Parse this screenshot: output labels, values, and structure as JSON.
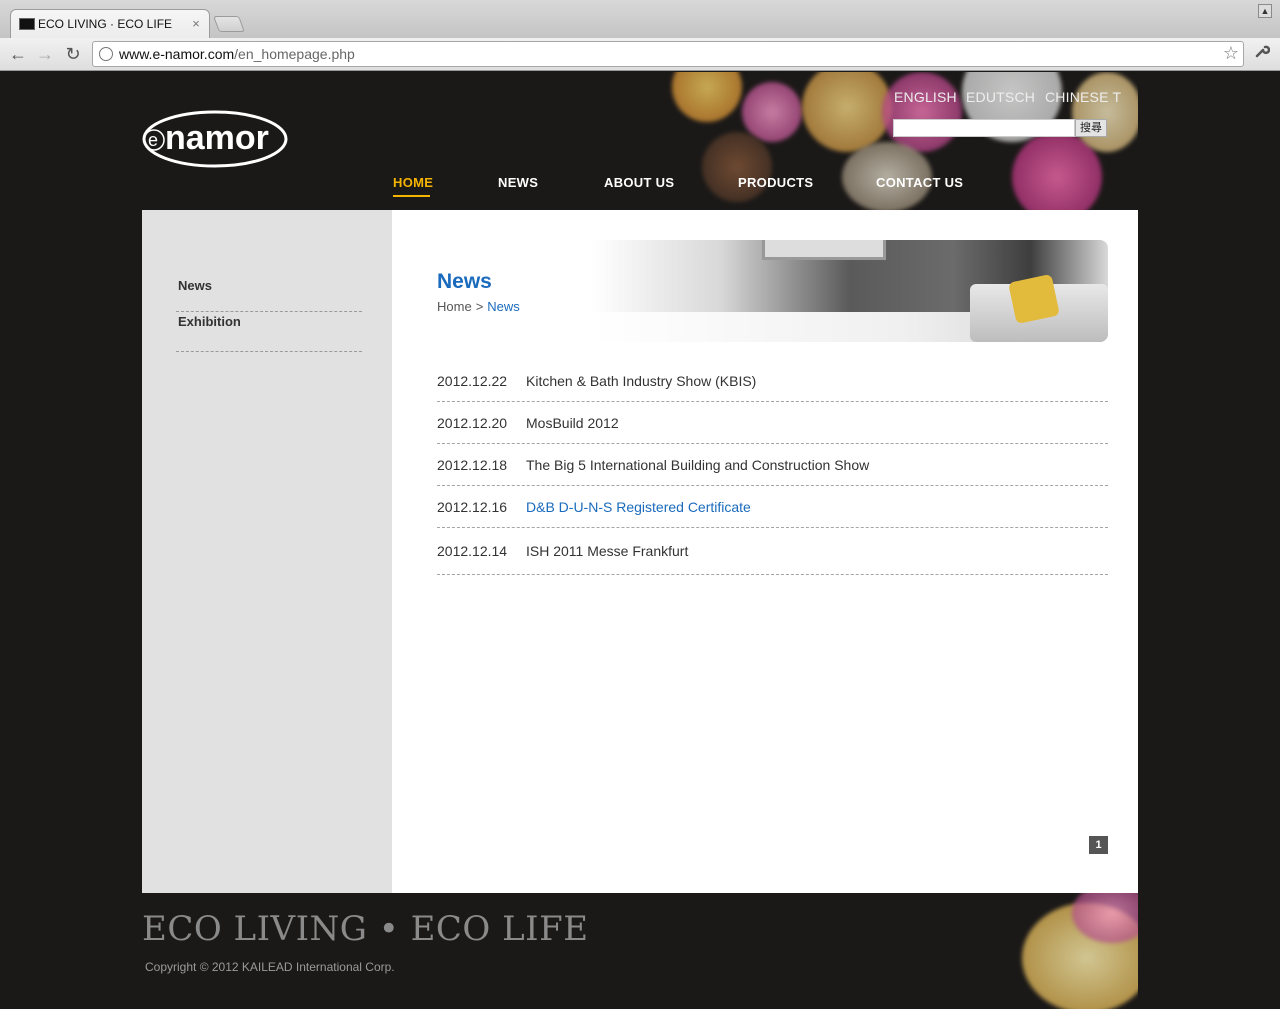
{
  "browser": {
    "tab_title": "ECO LIVING · ECO LIFE",
    "tab_close": "×",
    "url_host": "www.e-namor.com",
    "url_path": "/en_homepage.php",
    "back": "←",
    "forward": "→",
    "reload": "↻",
    "star": "☆",
    "wrench": "🔧"
  },
  "header": {
    "logo_text": "namor",
    "logo_e": "e",
    "languages": [
      "ENGLISH",
      "EDUTSCH",
      "CHINESE T"
    ],
    "search_button": "搜尋",
    "search_placeholder": "",
    "nav": [
      "HOME",
      "NEWS",
      "ABOUT US",
      "PRODUCTS",
      "CONTACT US"
    ],
    "active_nav": "HOME"
  },
  "sidebar": {
    "items": [
      "News",
      "Exhibition"
    ]
  },
  "main": {
    "title": "News",
    "breadcrumb": {
      "home": "Home",
      "sep": ">",
      "current": "News"
    },
    "news": [
      {
        "date": "2012.12.22",
        "title": "Kitchen & Bath Industry Show (KBIS)"
      },
      {
        "date": "2012.12.20",
        "title": "MosBuild 2012"
      },
      {
        "date": "2012.12.18",
        "title": "The Big 5 International Building and Construction Show"
      },
      {
        "date": "2012.12.16",
        "title": "D&B D-U-N-S Registered Certificate"
      },
      {
        "date": "2012.12.14",
        "title": "ISH 2011 Messe Frankfurt"
      }
    ],
    "page_number": "1"
  },
  "footer": {
    "slogan": "ECO LIVING • ECO LIFE",
    "copyright": "Copyright ©  2012 KAILEAD International Corp."
  },
  "colors": {
    "accent": "#f5b400",
    "link": "#1a6bbd",
    "background": "#1b1918",
    "sidebar": "#e1e1e1"
  }
}
